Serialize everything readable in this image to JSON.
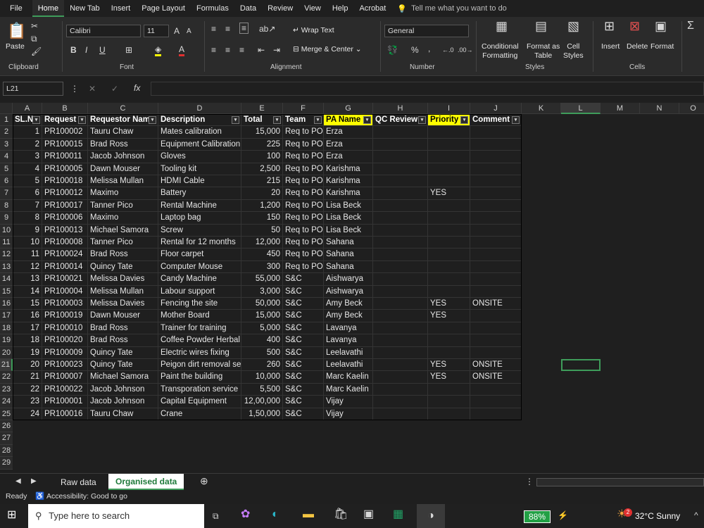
{
  "menu": [
    "File",
    "Home",
    "New Tab",
    "Insert",
    "Page Layout",
    "Formulas",
    "Data",
    "Review",
    "View",
    "Help",
    "Acrobat"
  ],
  "tellme": "Tell me what you want to do",
  "ribbon": {
    "clipboard": {
      "paste": "Paste",
      "label": "Clipboard"
    },
    "font": {
      "name": "Calibri",
      "size": "11",
      "label": "Font",
      "bold": "B",
      "italic": "I",
      "underline": "U"
    },
    "alignment": {
      "wrap": "Wrap Text",
      "merge": "Merge & Center",
      "label": "Alignment"
    },
    "number": {
      "format": "General",
      "label": "Number",
      "percent": "%",
      "comma": ","
    },
    "styles": {
      "cond1": "Conditional",
      "cond2": "Formatting",
      "fmt1": "Format as",
      "fmt2": "Table",
      "cell1": "Cell",
      "cell2": "Styles",
      "label": "Styles"
    },
    "cells": {
      "insert": "Insert",
      "delete": "Delete",
      "format": "Format",
      "label": "Cells"
    }
  },
  "namebox": "L21",
  "fx": "fx",
  "columns": [
    "A",
    "B",
    "C",
    "D",
    "E",
    "F",
    "G",
    "H",
    "I",
    "J",
    "K",
    "L",
    "M",
    "N",
    "O"
  ],
  "headers": [
    "SL.N",
    "Request",
    "Requestor Nam",
    "Description",
    "Total",
    "Team",
    "PA Name",
    "QC Review",
    "Priority",
    "Comment"
  ],
  "rows": [
    [
      "1",
      "PR100002",
      "Tauru Chaw",
      "Mates calibration",
      "15,000",
      "Req to PO",
      "Erza",
      "",
      "",
      ""
    ],
    [
      "2",
      "PR100015",
      "Brad Ross",
      "Equipment Calibration",
      "225",
      "Req to PO",
      "Erza",
      "",
      "",
      ""
    ],
    [
      "3",
      "PR100011",
      "Jacob Johnson",
      "Gloves",
      "100",
      "Req to PO",
      "Erza",
      "",
      "",
      ""
    ],
    [
      "4",
      "PR100005",
      "Dawn Mouser",
      "Tooling kit",
      "2,500",
      "Req to PO",
      "Karishma",
      "",
      "",
      ""
    ],
    [
      "5",
      "PR100018",
      "Melissa Mullan",
      "HDMI Cable",
      "215",
      "Req to PO",
      "Karishma",
      "",
      "",
      ""
    ],
    [
      "6",
      "PR100012",
      "Maximo",
      "Battery",
      "20",
      "Req to PO",
      "Karishma",
      "",
      "YES",
      ""
    ],
    [
      "7",
      "PR100017",
      "Tanner Pico",
      "Rental Machine",
      "1,200",
      "Req to PO",
      "Lisa Beck",
      "",
      "",
      ""
    ],
    [
      "8",
      "PR100006",
      "Maximo",
      "Laptop bag",
      "150",
      "Req to PO",
      "Lisa Beck",
      "",
      "",
      ""
    ],
    [
      "9",
      "PR100013",
      "Michael Samora",
      "Screw",
      "50",
      "Req to PO",
      "Lisa Beck",
      "",
      "",
      ""
    ],
    [
      "10",
      "PR100008",
      "Tanner Pico",
      "Rental for 12 months",
      "12,000",
      "Req to PO",
      "Sahana",
      "",
      "",
      ""
    ],
    [
      "11",
      "PR100024",
      "Brad Ross",
      "Floor carpet",
      "450",
      "Req to PO",
      "Sahana",
      "",
      "",
      ""
    ],
    [
      "12",
      "PR100014",
      "Quincy Tate",
      "Computer Mouse",
      "300",
      "Req to PO",
      "Sahana",
      "",
      "",
      ""
    ],
    [
      "13",
      "PR100021",
      "Melissa Davies",
      "Candy Machine",
      "55,000",
      "S&C",
      "Aishwarya",
      "",
      "",
      ""
    ],
    [
      "14",
      "PR100004",
      "Melissa Mullan",
      "Labour support",
      "3,000",
      "S&C",
      "Aishwarya",
      "",
      "",
      ""
    ],
    [
      "15",
      "PR100003",
      "Melissa Davies",
      "Fencing the site",
      "50,000",
      "S&C",
      "Amy Beck",
      "",
      "YES",
      "ONSITE"
    ],
    [
      "16",
      "PR100019",
      "Dawn Mouser",
      "Mother Board",
      "15,000",
      "S&C",
      "Amy Beck",
      "",
      "YES",
      ""
    ],
    [
      "17",
      "PR100010",
      "Brad Ross",
      "Trainer for training",
      "5,000",
      "S&C",
      "Lavanya",
      "",
      "",
      ""
    ],
    [
      "18",
      "PR100020",
      "Brad Ross",
      "Coffee Powder Herbal",
      "400",
      "S&C",
      "Lavanya",
      "",
      "",
      ""
    ],
    [
      "19",
      "PR100009",
      "Quincy Tate",
      "Electric wires fixing",
      "500",
      "S&C",
      "Leelavathi",
      "",
      "",
      ""
    ],
    [
      "20",
      "PR100023",
      "Quincy Tate",
      "Peigon dirt removal se",
      "260",
      "S&C",
      "Leelavathi",
      "",
      "YES",
      "ONSITE"
    ],
    [
      "21",
      "PR100007",
      "Michael Samora",
      "Paint the building",
      "10,000",
      "S&C",
      "Marc Kaelin",
      "",
      "YES",
      "ONSITE"
    ],
    [
      "22",
      "PR100022",
      "Jacob Johnson",
      "Transporation service",
      "5,500",
      "S&C",
      "Marc Kaelin",
      "",
      "",
      ""
    ],
    [
      "23",
      "PR100001",
      "Jacob Johnson",
      "Capital Equipment",
      "12,00,000",
      "S&C",
      "Vijay",
      "",
      "",
      ""
    ],
    [
      "24",
      "PR100016",
      "Tauru Chaw",
      "Crane",
      "1,50,000",
      "S&C",
      "Vijay",
      "",
      "",
      ""
    ]
  ],
  "row_numbers": [
    "1",
    "2",
    "3",
    "4",
    "5",
    "6",
    "7",
    "8",
    "9",
    "10",
    "11",
    "12",
    "13",
    "14",
    "15",
    "16",
    "17",
    "18",
    "19",
    "20",
    "21",
    "22",
    "23",
    "24",
    "25",
    "26",
    "27",
    "28",
    "29"
  ],
  "sheets": [
    "Raw data",
    "Organised data"
  ],
  "active_sheet": "Organised data",
  "status": {
    "ready": "Ready",
    "accessibility": "Accessibility: Good to go"
  },
  "taskbar": {
    "search": "Type here to search",
    "battery": "88%",
    "weather": "32°C  Sunny",
    "badge": "2"
  },
  "colors": {
    "accent": "#3e9c5a",
    "highlight": "#ffff00"
  }
}
